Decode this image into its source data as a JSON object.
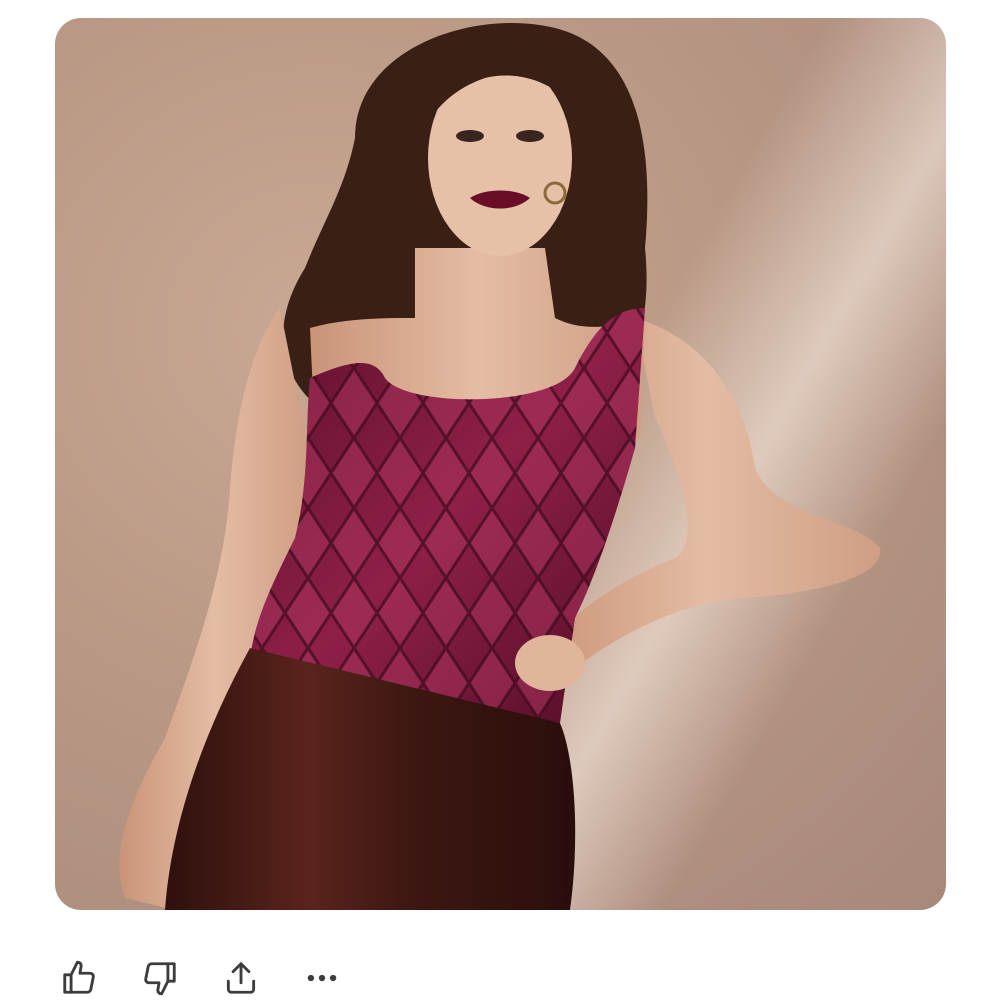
{
  "image": {
    "subject": "generated-fashion-photo",
    "colors": {
      "background": "#c4a392",
      "top": "#7a1a3c",
      "skirt": "#3f1914",
      "hair": "#3a1f14",
      "skin": "#e2b9a0"
    }
  },
  "actions": [
    {
      "icon": "thumbs-up-icon"
    },
    {
      "icon": "thumbs-down-icon"
    },
    {
      "icon": "share-icon"
    },
    {
      "icon": "more-icon"
    }
  ],
  "theme": {
    "icon_color": "#3c3c3c"
  }
}
